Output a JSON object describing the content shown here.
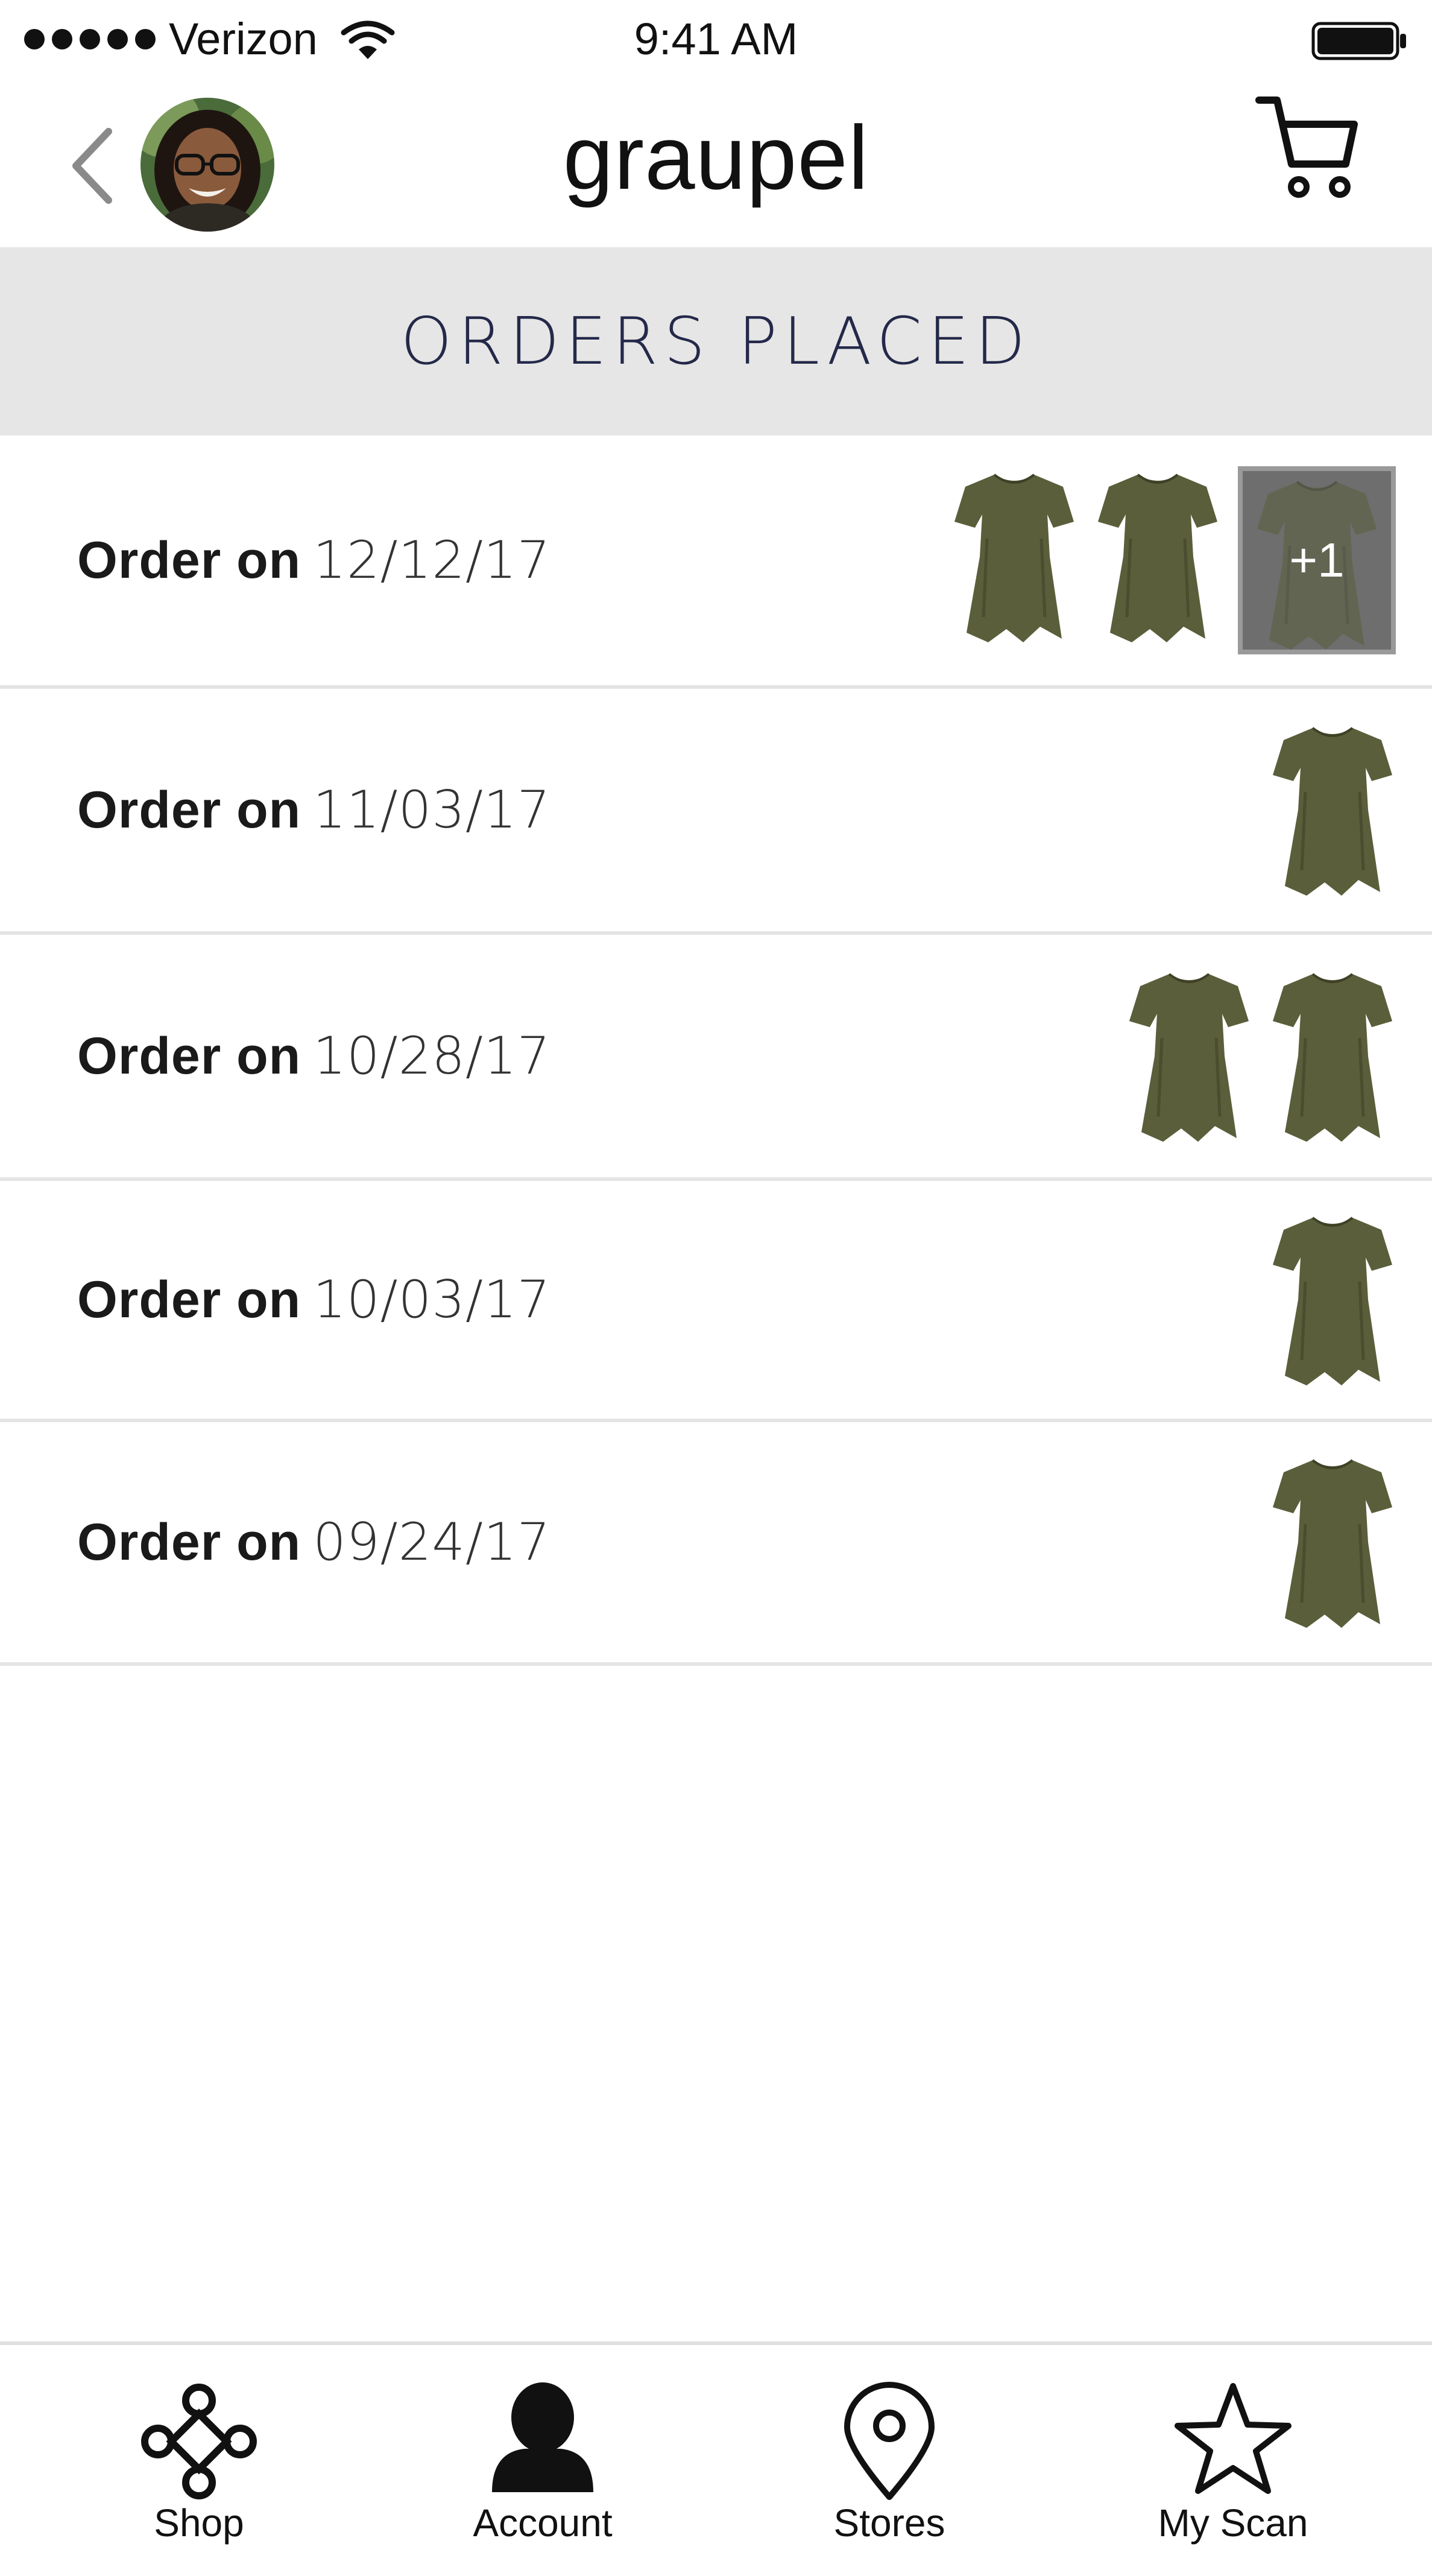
{
  "status_bar": {
    "carrier": "Verizon",
    "time": "9:41 AM"
  },
  "nav": {
    "brand": "graupel"
  },
  "section": {
    "title": "ORDERS PLACED"
  },
  "orders": [
    {
      "prefix": "Order on",
      "date": "12/12/17",
      "items_shown": 2,
      "more_label": "+1"
    },
    {
      "prefix": "Order on",
      "date": "11/03/17",
      "items_shown": 1
    },
    {
      "prefix": "Order on",
      "date": "10/28/17",
      "items_shown": 2
    },
    {
      "prefix": "Order on",
      "date": "10/03/17",
      "items_shown": 1
    },
    {
      "prefix": "Order on",
      "date": "09/24/17",
      "items_shown": 1
    }
  ],
  "tabs": [
    {
      "label": "Shop",
      "icon": "shop-knot-icon"
    },
    {
      "label": "Account",
      "icon": "person-icon"
    },
    {
      "label": "Stores",
      "icon": "map-pin-icon"
    },
    {
      "label": "My Scan",
      "icon": "star-icon"
    }
  ],
  "colors": {
    "header_bg": "#e6e6e6",
    "section_title": "#24294a",
    "shirt": "#5a5e3a"
  }
}
